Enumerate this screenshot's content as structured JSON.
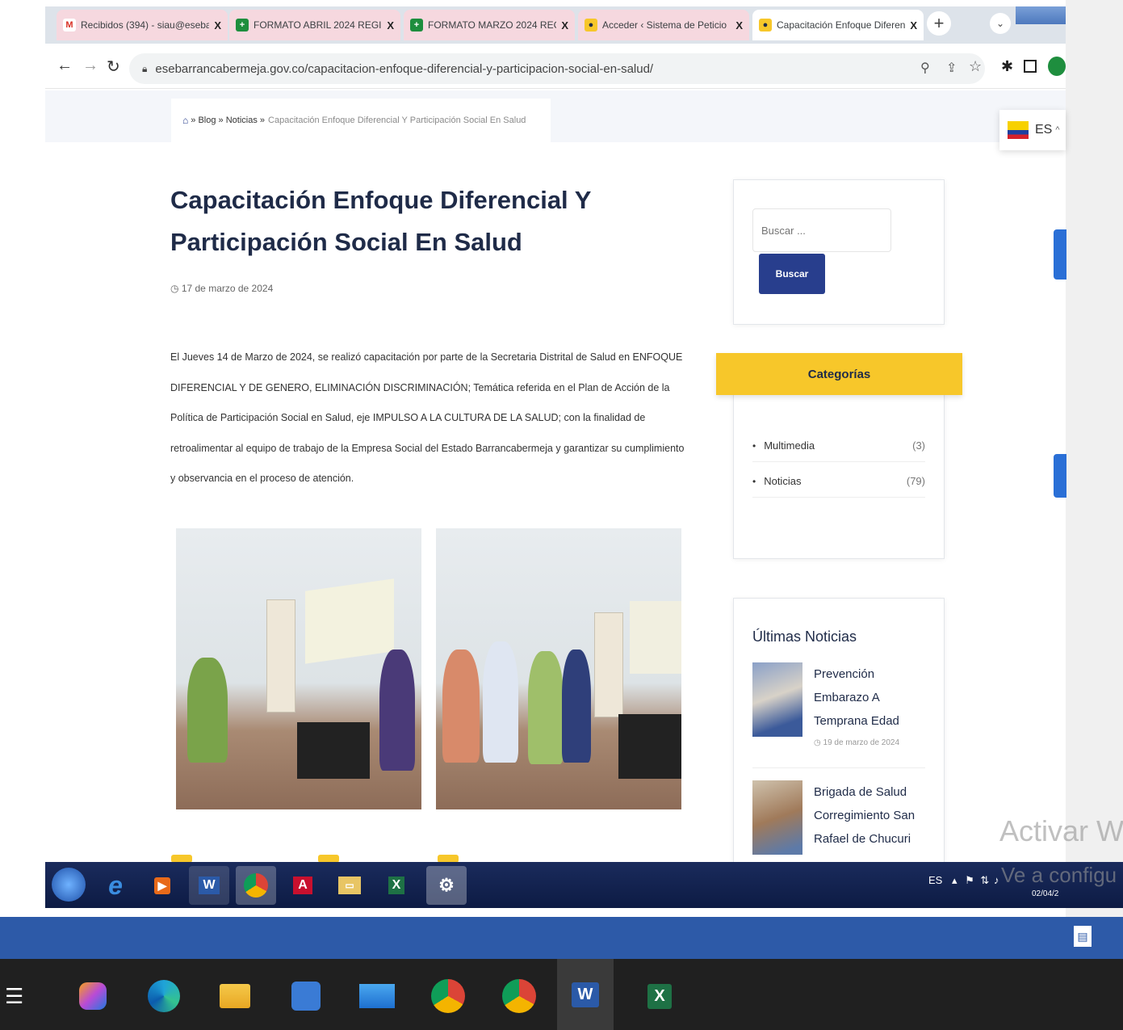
{
  "browser": {
    "tabs": [
      {
        "label": "Recibidos (394) - siau@esebar",
        "icon": "gmail-icon"
      },
      {
        "label": "FORMATO ABRIL 2024 REGIST",
        "icon": "sheets-icon"
      },
      {
        "label": "FORMATO MARZO 2024 REG",
        "icon": "sheets-icon"
      },
      {
        "label": "Acceder ‹ Sistema de Peticio",
        "icon": "site-icon"
      },
      {
        "label": "Capacitación Enfoque Diferen",
        "icon": "site-icon"
      }
    ],
    "tab_close": "X",
    "url": "esebarrancabermeja.gov.co/capacitacion-enfoque-diferencial-y-participacion-social-en-salud/"
  },
  "breadcrumb": {
    "sep": "»",
    "blog": "Blog",
    "noticias": "Noticias",
    "current": "Capacitación Enfoque Diferencial Y Participación Social En Salud"
  },
  "language": {
    "code": "ES"
  },
  "post": {
    "title": "Capacitación Enfoque Diferencial Y Participación Social En Salud",
    "date": "17 de marzo de 2024",
    "body": "El Jueves 14 de Marzo de 2024, se realizó capacitación por parte de la Secretaria Distrital de Salud en ENFOQUE DIFERENCIAL Y DE GENERO, ELIMINACIÓN DISCRIMINACIÓN; Temática referida en el Plan de Acción de la Política de Participación Social en Salud, eje IMPULSO A LA CULTURA DE LA SALUD; con la finalidad de retroalimentar al equipo de trabajo de la Empresa Social del Estado Barrancabermeja y garantizar su cumplimiento y observancia en el proceso de atención."
  },
  "sidebar": {
    "search_placeholder": "Buscar ...",
    "search_button": "Buscar",
    "categories_title": "Categorías",
    "categories": [
      {
        "name": "Multimedia",
        "count": "(3)"
      },
      {
        "name": "Noticias",
        "count": "(79)"
      }
    ],
    "news_title": "Últimas Noticias",
    "news": [
      {
        "title": "Prevención Embarazo A Temprana Edad",
        "date": "19 de marzo de 2024"
      },
      {
        "title": "Brigada de Salud Corregimiento San Rafael de Chucuri",
        "date": ""
      }
    ]
  },
  "watermark": {
    "line1": "Activar W",
    "line2": "Ve a configu"
  },
  "taskbar7": {
    "lang": "ES",
    "date": "02/04/2"
  },
  "colors": {
    "accent_yellow": "#f7c72a",
    "accent_blue": "#283e8d",
    "heading": "#1f2b48"
  }
}
